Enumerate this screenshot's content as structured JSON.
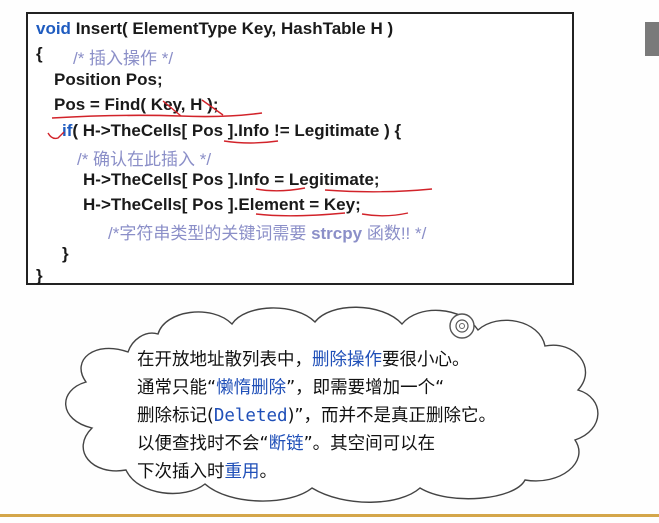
{
  "code": {
    "line1_kw": "void",
    "line1_rest": "Insert( ElementType Key, HashTable H )",
    "line2_brace": "{",
    "line2_comment": "/* 插入操作 */",
    "line3": "Position Pos;",
    "line4": "Pos = Find( Key, H );",
    "line5_kw": "if",
    "line5_rest": "( H->TheCells[ Pos ].Info != Legitimate ) {",
    "line6_comment": "/* 确认在此插入 */",
    "line7": "H->TheCells[ Pos ].Info = Legitimate;",
    "line8": "H->TheCells[ Pos ].Element = Key;",
    "line9_comment_a": "/*字符串类型的关键词需要 ",
    "line9_comment_b": "strcpy",
    "line9_comment_c": " 函数!! */",
    "line10": "}",
    "line11": "}"
  },
  "note": {
    "l1a": "在开放地址散列表中，",
    "l1b": "删除操作",
    "l1c": "要很小心。",
    "l2a": "通常只能“",
    "l2b": "懒惰删除",
    "l2c": "”，即需要增加一个“",
    "l3a": "删除标记(",
    "l3b": "Deleted",
    "l3c": ")”，而并不是真正删除它。",
    "l4a": "以便查找时不会“",
    "l4b": "断链",
    "l4c": "”。其空间可以在",
    "l5a": "下次插入时",
    "l5b": "重用",
    "l5c": "。"
  },
  "colors": {
    "keyword": "#1f5cc0",
    "comment": "#8b8fc8",
    "highlight": "#1f4fb8",
    "annotation": "#d2232a"
  }
}
